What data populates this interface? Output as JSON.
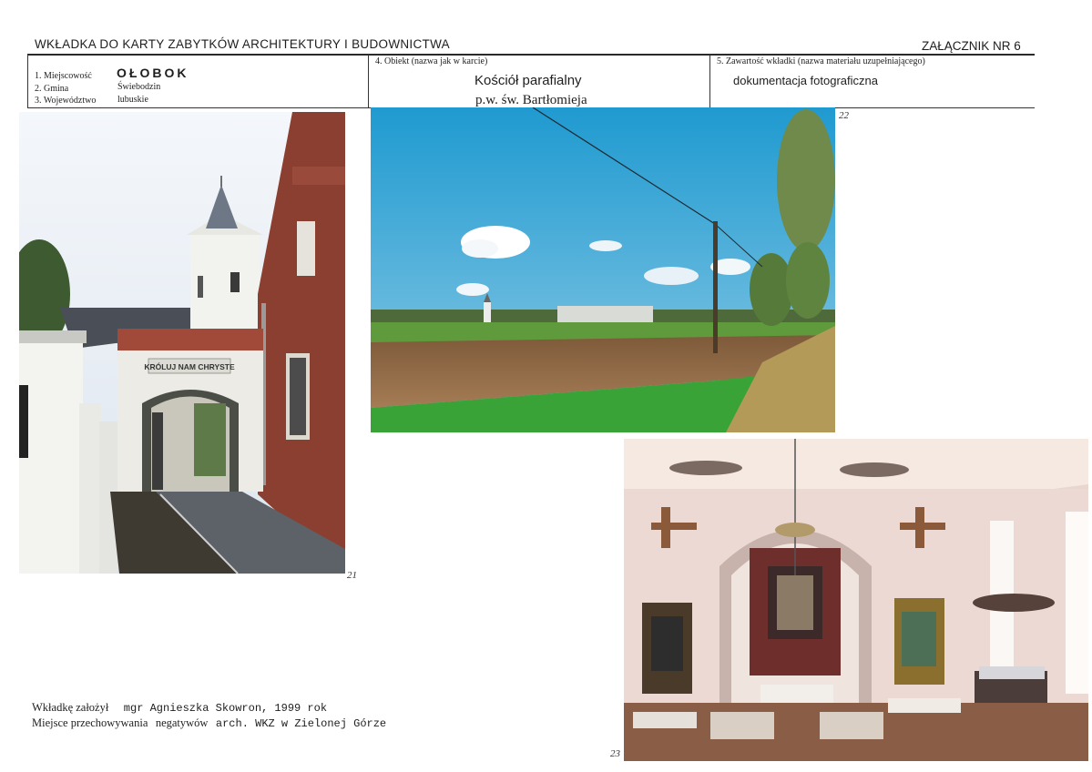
{
  "header": {
    "title": "WKŁADKA DO KARTY ZABYTKÓW ARCHITEKTURY I BUDOWNICTWA",
    "annex": "ZAŁĄCZNIK NR 6"
  },
  "location": {
    "miejscowosc_label": "1. Miejscowość",
    "miejscowosc_value": "OŁOBOK",
    "gmina_label": "2. Gmina",
    "gmina_value": "Świebodzin",
    "wojewodztwo_label": "3. Województwo",
    "wojewodztwo_value": "lubuskie"
  },
  "object": {
    "label": "4. Obiekt (nazwa jak w karcie)",
    "name_line1": "Kościół parafialny",
    "name_line2": "p.w. św. Bartłomieja"
  },
  "contents": {
    "label": "5. Zawartość wkładki (nazwa materiału uzupełniającego)",
    "value": "dokumentacja fotograficzna"
  },
  "photos": [
    {
      "number": "21",
      "gate_sign": "KRÓLUJ NAM CHRYSTE"
    },
    {
      "number": "22"
    },
    {
      "number": "23"
    }
  ],
  "footer": {
    "author_label": "Wkładkę założył",
    "author_value": "mgr Agnieszka Skowron, 1999 rok",
    "storage_label": "Miejsce przechowywania",
    "storage_value_a": "negatywów",
    "storage_value_b": "arch. WKZ w Zielonej Górze"
  }
}
